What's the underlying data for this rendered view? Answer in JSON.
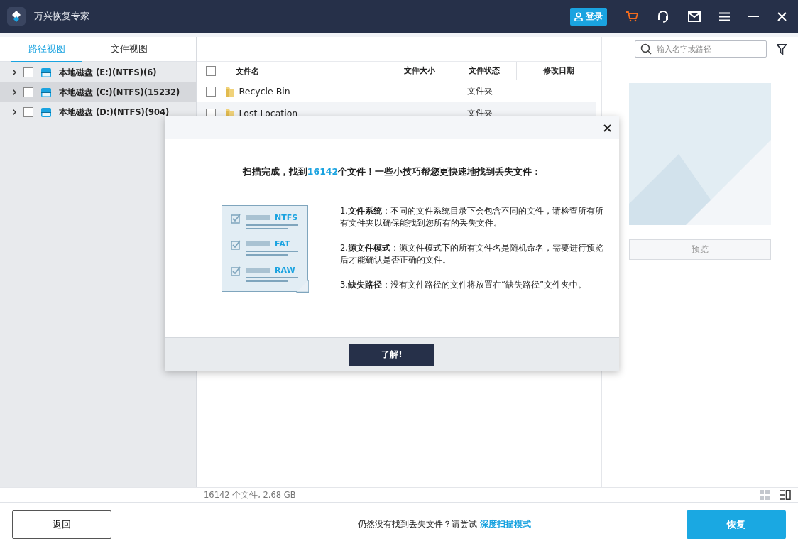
{
  "window": {
    "title": "万兴恢复专家",
    "login": "登录"
  },
  "tabs": [
    {
      "label": "路径视图",
      "selected": true
    },
    {
      "label": "文件视图",
      "selected": false
    }
  ],
  "tree": [
    {
      "label": "本地磁盘 (E:)(NTFS)(6)",
      "checked": false,
      "selected": false
    },
    {
      "label": "本地磁盘 (C:)(NTFS)(15232)",
      "checked": false,
      "selected": true
    },
    {
      "label": "本地磁盘 (D:)(NTFS)(904)",
      "checked": false,
      "selected": false
    }
  ],
  "search": {
    "placeholder": "输入名字或路径"
  },
  "table": {
    "select_all_checked": false,
    "columns": [
      "文件名",
      "文件大小",
      "文件状态",
      "修改日期"
    ],
    "rows": [
      {
        "name": "Recycle Bin",
        "size": "--",
        "status": "文件夹",
        "date": "--",
        "checked": false
      },
      {
        "name": "Lost Location",
        "size": "--",
        "status": "文件夹",
        "date": "--",
        "checked": false
      }
    ]
  },
  "preview": {
    "button": "预览"
  },
  "status_bar": "16142 个文件, 2.68  GB",
  "dialog": {
    "title_before": "扫描完成，找到",
    "count": "16142",
    "title_after": "个文件！一些小技巧帮您更快速地找到丢失文件：",
    "labels": [
      "NTFS",
      "FAT",
      "RAW"
    ],
    "tips": [
      "1.**文件系统**：不同的文件系统目录下会包含不同的文件，请检查所有所有文件夹以确保能找到您所有的丢失文件。",
      "2.**源文件模式**：源文件模式下的所有文件名是随机命名，需要进行预览后才能确认是否正确的文件。",
      "3.**缺失路径**：没有文件路径的文件将放置在“缺失路径”文件夹中。"
    ],
    "button": "了解!"
  },
  "footer": {
    "back": "返回",
    "hint": "仍然没有找到丢失文件？请尝试",
    "link": "深度扫描模式",
    "recover": "恢复"
  }
}
